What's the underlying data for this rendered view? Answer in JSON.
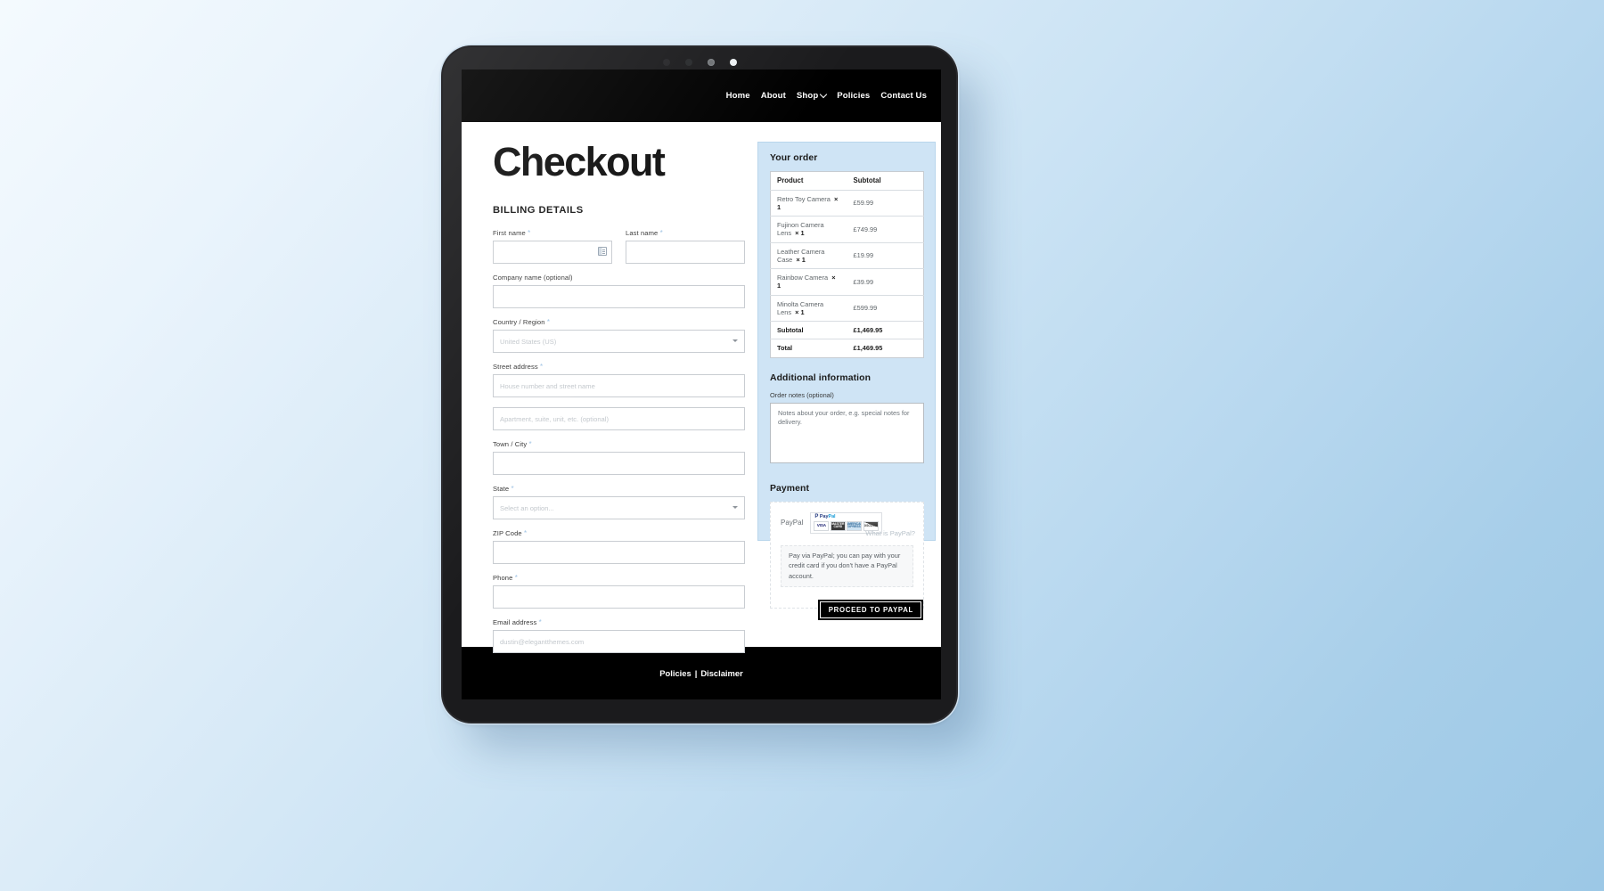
{
  "device": {
    "sensor_dots": [
      "dot-1",
      "dot-2",
      "dot-3",
      "dot-4"
    ]
  },
  "header": {
    "nav": [
      {
        "label": "Home",
        "has_dropdown": false
      },
      {
        "label": "About",
        "has_dropdown": false
      },
      {
        "label": "Shop",
        "has_dropdown": true
      },
      {
        "label": "Policies",
        "has_dropdown": false
      },
      {
        "label": "Contact Us",
        "has_dropdown": false
      }
    ]
  },
  "main": {
    "page_title": "Checkout",
    "billing": {
      "heading": "BILLING DETAILS",
      "fields": {
        "first_name": {
          "label": "First name",
          "required": true,
          "value": "",
          "placeholder": ""
        },
        "last_name": {
          "label": "Last name",
          "required": true,
          "value": "",
          "placeholder": ""
        },
        "company_name": {
          "label": "Company name (optional)",
          "required": false,
          "value": "",
          "placeholder": ""
        },
        "country": {
          "label": "Country / Region",
          "required": true,
          "value": "United States (US)"
        },
        "street_1": {
          "label": "Street address",
          "required": true,
          "value": "",
          "placeholder": "House number and street name"
        },
        "street_2": {
          "label": "",
          "required": false,
          "value": "",
          "placeholder": "Apartment, suite, unit, etc. (optional)"
        },
        "town_city": {
          "label": "Town / City",
          "required": true,
          "value": "",
          "placeholder": ""
        },
        "state": {
          "label": "State",
          "required": true,
          "value": "Select an option..."
        },
        "zip_code": {
          "label": "ZIP Code",
          "required": true,
          "value": "",
          "placeholder": ""
        },
        "phone": {
          "label": "Phone",
          "required": true,
          "value": "",
          "placeholder": ""
        },
        "email": {
          "label": "Email address",
          "required": true,
          "value": "",
          "placeholder": "dustin@elegantthemes.com"
        }
      },
      "required_marker": "*"
    }
  },
  "order_panel": {
    "heading": "Your order",
    "table": {
      "columns": [
        "Product",
        "Subtotal"
      ],
      "rows": [
        {
          "product": "Retro Toy Camera",
          "qty": "× 1",
          "subtotal": "£59.99"
        },
        {
          "product": "Fujinon Camera Lens",
          "qty": "× 1",
          "subtotal": "£749.99"
        },
        {
          "product": "Leather Camera Case",
          "qty": "× 1",
          "subtotal": "£19.99"
        },
        {
          "product": "Rainbow Camera",
          "qty": "× 1",
          "subtotal": "£39.99"
        },
        {
          "product": "Minolta Camera Lens",
          "qty": "× 1",
          "subtotal": "£599.99"
        }
      ],
      "totals": [
        {
          "label": "Subtotal",
          "value": "£1,469.95"
        },
        {
          "label": "Total",
          "value": "£1,469.95"
        }
      ]
    },
    "additional_information": {
      "heading": "Additional information",
      "order_notes_label": "Order notes (optional)",
      "order_notes_value": "",
      "order_notes_placeholder": "Notes about your order, e.g. special notes for delivery."
    },
    "payment": {
      "heading": "Payment",
      "method_label": "PayPal",
      "badge": {
        "glyph": "P",
        "word_dark": "Pay",
        "word_light": "Pal"
      },
      "card_marks": [
        "VISA",
        "MASTER CARD",
        "AMERICAN EXPRESS",
        "DISCOVER"
      ],
      "what_is_link": "What is PayPal?",
      "description": "Pay via PayPal; you can pay with your credit card if you don't have a PayPal account.",
      "submit_label": "PROCEED TO PAYPAL"
    }
  },
  "footer": {
    "links": [
      "Policies",
      "Disclaimer"
    ],
    "separator": "|"
  },
  "colors": {
    "nav_bar": "#000000",
    "panel_bg": "#cfe4f5",
    "panel_border": "#b9d6ec",
    "button_bg": "#000000",
    "required_marker": "#9fc3e4",
    "page_bg_start": "#f4fafe",
    "page_bg_end": "#9cc8e6"
  }
}
